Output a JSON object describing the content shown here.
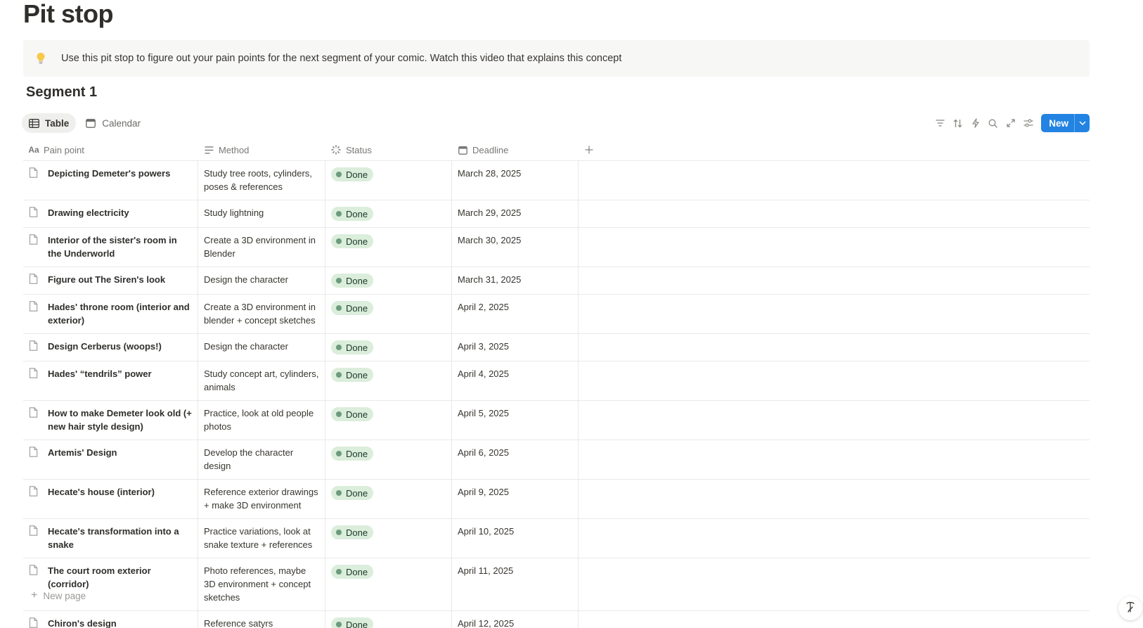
{
  "page": {
    "title": "Pit stop",
    "callout": {
      "icon": "lightbulb-icon",
      "text": "Use this pit stop to figure out your pain points for the next segment of your comic. Watch this video that explains this concept"
    },
    "segment_title": "Segment 1"
  },
  "views": [
    {
      "label": "Table",
      "icon": "table-icon",
      "active": true
    },
    {
      "label": "Calendar",
      "icon": "calendar-icon",
      "active": false
    }
  ],
  "toolbar": {
    "icons": [
      "filter-icon",
      "sort-icon",
      "automation-icon",
      "search-icon",
      "expand-icon",
      "settings-icon"
    ],
    "new_label": "New"
  },
  "table": {
    "columns": [
      {
        "label": "Pain point",
        "icon": "title-aa-icon"
      },
      {
        "label": "Method",
        "icon": "text-lines-icon"
      },
      {
        "label": "Status",
        "icon": "status-loader-icon"
      },
      {
        "label": "Deadline",
        "icon": "calendar-icon"
      }
    ],
    "rows": [
      {
        "pain_point": "Depicting Demeter's powers",
        "method": "Study tree roots, cylinders, poses & references",
        "status": "Done",
        "deadline": "March 28, 2025"
      },
      {
        "pain_point": "Drawing electricity",
        "method": "Study lightning",
        "status": "Done",
        "deadline": "March 29, 2025"
      },
      {
        "pain_point": "Interior of the sister's room in the Underworld",
        "method": "Create a 3D environment in Blender",
        "status": "Done",
        "deadline": "March 30, 2025"
      },
      {
        "pain_point": "Figure out The Siren's look",
        "method": "Design the character",
        "status": "Done",
        "deadline": "March 31, 2025"
      },
      {
        "pain_point": "Hades' throne room (interior and exterior)",
        "method": "Create a 3D environment in blender + concept sketches",
        "status": "Done",
        "deadline": "April 2, 2025"
      },
      {
        "pain_point": "Design Cerberus (woops!)",
        "method": "Design the character",
        "status": "Done",
        "deadline": "April 3, 2025"
      },
      {
        "pain_point": "Hades' “tendrils” power",
        "method": "Study concept art, cylinders, animals",
        "status": "Done",
        "deadline": "April 4, 2025"
      },
      {
        "pain_point": "How to make Demeter look old (+ new hair style design)",
        "method": "Practice, look at old people photos",
        "status": "Done",
        "deadline": "April 5, 2025"
      },
      {
        "pain_point": "Artemis' Design",
        "method": "Develop the character design",
        "status": "Done",
        "deadline": "April 6, 2025"
      },
      {
        "pain_point": "Hecate's house (interior)",
        "method": "Reference exterior drawings + make 3D environment",
        "status": "Done",
        "deadline": "April 9, 2025"
      },
      {
        "pain_point": "Hecate's transformation into a snake",
        "method": "Practice variations, look at snake texture + references",
        "status": "Done",
        "deadline": "April 10, 2025"
      },
      {
        "pain_point": "The court room exterior (corridor)",
        "method": "Photo references, maybe 3D environment + concept sketches",
        "status": "Done",
        "deadline": "April 11, 2025"
      },
      {
        "pain_point": "Chiron's design",
        "method": "Reference satyrs",
        "status": "Done",
        "deadline": "April 12, 2025"
      }
    ],
    "new_page_label": "New page"
  },
  "colors": {
    "accent": "#2383e2",
    "status_done_bg": "#dbeddb",
    "status_done_dot": "#6c9b7d",
    "callout_bg": "#f7f7f5"
  }
}
